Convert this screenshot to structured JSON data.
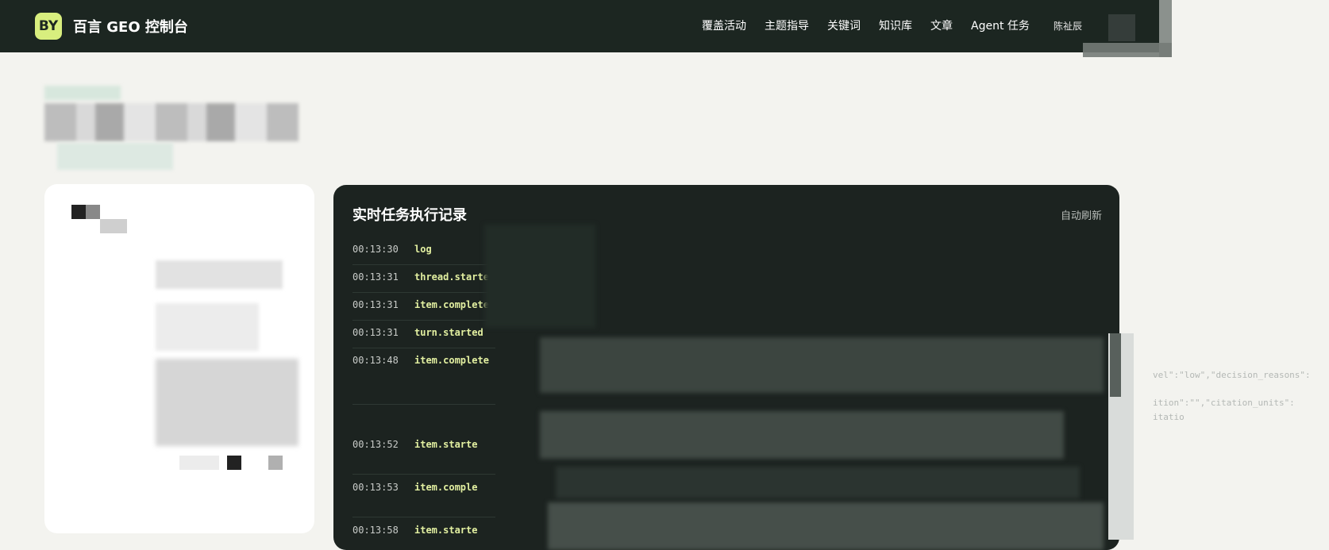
{
  "header": {
    "logo_text": "BY",
    "app_title": "百言 GEO 控制台",
    "nav": [
      "覆盖活动",
      "主题指导",
      "关键词",
      "知识库",
      "文章",
      "Agent 任务"
    ],
    "user_name": "陈祉辰"
  },
  "log_panel": {
    "title": "实时任务执行记录",
    "auto_refresh": "自动刷新",
    "rows": [
      {
        "time": "00:13:30",
        "event": "log"
      },
      {
        "time": "00:13:31",
        "event": "thread.started"
      },
      {
        "time": "00:13:31",
        "event": "item.completed"
      },
      {
        "time": "00:13:31",
        "event": "turn.started"
      },
      {
        "time": "00:13:48",
        "event": "item.complete"
      },
      {
        "time": "00:13:52",
        "event": "item.starte"
      },
      {
        "time": "00:13:53",
        "event": "item.comple"
      },
      {
        "time": "00:13:58",
        "event": "item.starte"
      }
    ]
  },
  "stray_text": [
    "vel\":\"low\",\"decision_reasons\":",
    "ition\":\"\",\"citation_units\":",
    "itatio"
  ],
  "colors": {
    "topbar": "#1c2621",
    "logo_bg": "#d8ee7e",
    "log_event": "#e3f0a1",
    "page_bg": "#f3f3ef"
  }
}
